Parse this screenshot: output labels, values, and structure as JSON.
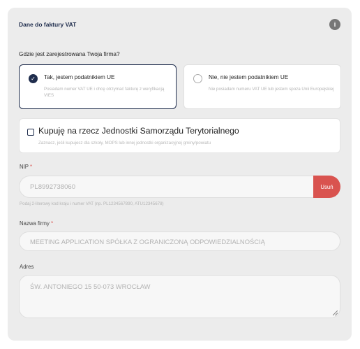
{
  "panel": {
    "title": "Dane do faktury VAT",
    "info_icon_glyph": "i"
  },
  "question": "Gdzie jest zarejestrowana Twoja firma?",
  "choices": [
    {
      "label": "Tak, jestem podatnikiem UE",
      "description": "Posiadam numer VAT UE i chcę otrzymać fakturę z weryfikacją VIES",
      "selected": true
    },
    {
      "label": "Nie, nie jestem podatnikiem UE",
      "description": "Nie posiadam numeru VAT UE lub jestem spoza Unii Europejskiej",
      "selected": false
    }
  ],
  "jst": {
    "label": "Kupuję na rzecz Jednostki Samorządu Terytorialnego",
    "description": "Zaznacz, jeśli kupujesz dla szkoły, MOPS lub innej jednostki organizacyjnej gminy/powiatu",
    "checked": false
  },
  "nip": {
    "label": "NIP",
    "required_mark": "*",
    "value": "PL8992738060",
    "remove_label": "Usuń",
    "hint": "Podaj 2-literowy kod kraju i numer VAT (np. PL1234567890, ATU12345678)"
  },
  "company": {
    "label": "Nazwa firmy",
    "required_mark": "*",
    "value": "MEETING APPLICATION SPÓŁKA Z OGRANICZONĄ ODPOWIEDZIALNOŚCIĄ"
  },
  "address": {
    "label": "Adres",
    "value": "ŚW. ANTONIEGO 15 50-073 WROCŁAW"
  },
  "colors": {
    "accent": "#1f2d4d",
    "danger": "#d9534f",
    "panel_bg": "#ececec"
  }
}
